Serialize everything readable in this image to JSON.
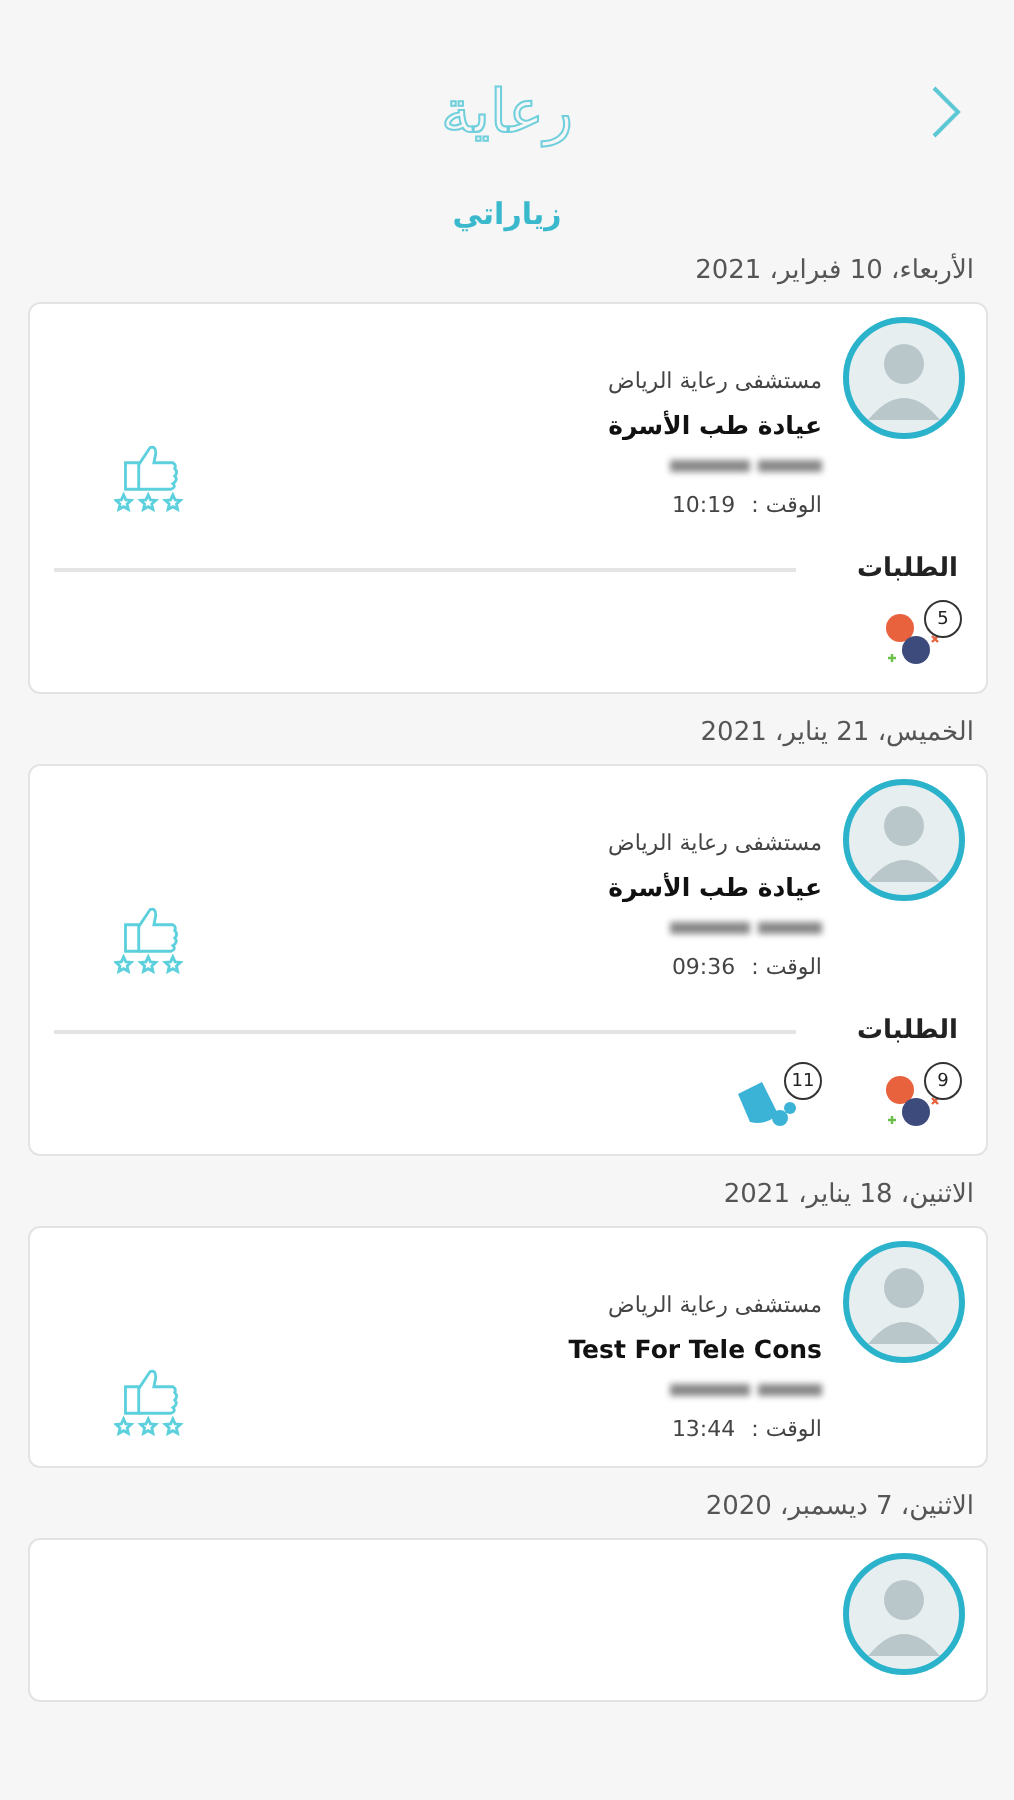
{
  "header": {
    "logo": "رعاية",
    "title": "زياراتي"
  },
  "visits": [
    {
      "date": "الأربعاء، 10 فبراير، 2021",
      "hospital": "مستشفى رعاية الرياض",
      "clinic": "عيادة طب الأسرة",
      "time_label": "الوقت :",
      "time": "10:19",
      "requests_label": "الطلبات",
      "requests": [
        {
          "kind": "medication",
          "count": "5"
        }
      ]
    },
    {
      "date": "الخميس، 21 يناير، 2021",
      "hospital": "مستشفى رعاية الرياض",
      "clinic": "عيادة طب الأسرة",
      "time_label": "الوقت :",
      "time": "09:36",
      "requests_label": "الطلبات",
      "requests": [
        {
          "kind": "medication",
          "count": "9"
        },
        {
          "kind": "lab",
          "count": "11"
        }
      ]
    },
    {
      "date": "الاثنين، 18 يناير، 2021",
      "hospital": "مستشفى رعاية الرياض",
      "clinic": "Test For Tele Cons",
      "time_label": "الوقت :",
      "time": "13:44"
    },
    {
      "date": "الاثنين، 7 ديسمبر، 2020"
    }
  ]
}
